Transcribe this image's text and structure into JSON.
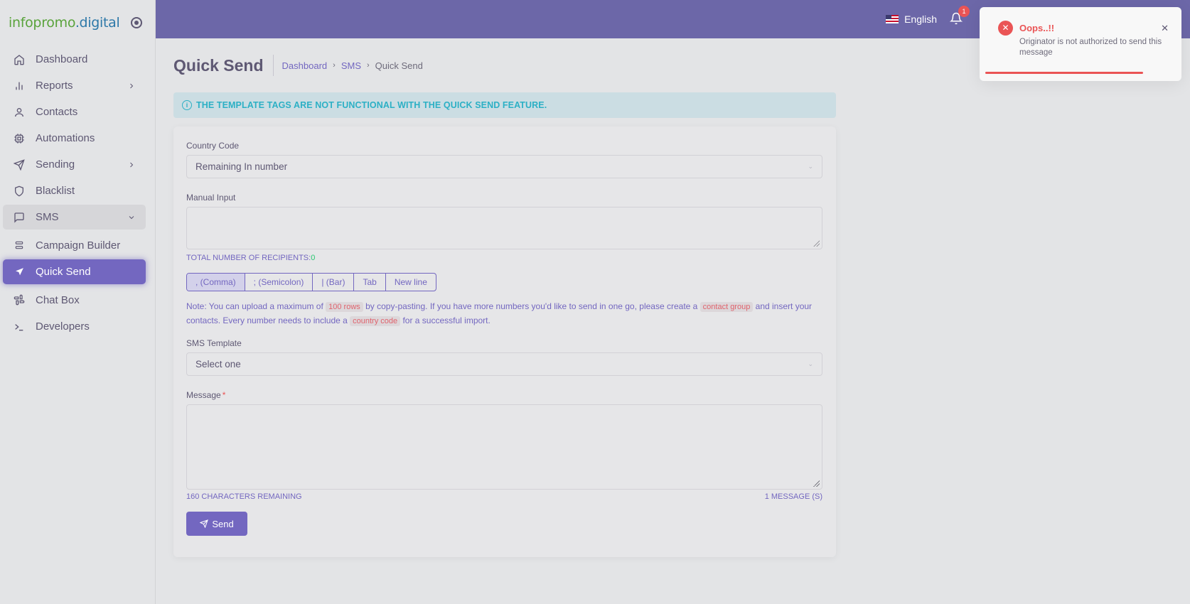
{
  "brand": {
    "part1": "infopromo",
    "part2": ".digital"
  },
  "sidebar": {
    "items": [
      {
        "label": "Dashboard"
      },
      {
        "label": "Reports"
      },
      {
        "label": "Contacts"
      },
      {
        "label": "Automations"
      },
      {
        "label": "Sending"
      },
      {
        "label": "Blacklist"
      },
      {
        "label": "SMS"
      },
      {
        "label": "Campaign Builder"
      },
      {
        "label": "Quick Send"
      },
      {
        "label": "Chat Box"
      },
      {
        "label": "Developers"
      }
    ]
  },
  "header": {
    "language": "English",
    "notifications_count": "1"
  },
  "page": {
    "title": "Quick Send",
    "breadcrumb": [
      "Dashboard",
      "SMS",
      "Quick Send"
    ]
  },
  "alert": {
    "text": "THE TEMPLATE TAGS ARE NOT FUNCTIONAL WITH THE QUICK SEND FEATURE."
  },
  "form": {
    "country_code_label": "Country Code",
    "country_code_value": "Remaining In number",
    "manual_input_label": "Manual Input",
    "recipients_label": "TOTAL NUMBER OF RECIPIENTS:",
    "recipients_count": "0",
    "delimiters": [
      ", (Comma)",
      "; (Semicolon)",
      "| (Bar)",
      "Tab",
      "New line"
    ],
    "note": {
      "p1": "Note: You can upload a maximum of ",
      "code1": "100 rows",
      "p2": " by copy-pasting. If you have more numbers you'd like to send in one go, please create a ",
      "code2": "contact group",
      "p3": " and insert your contacts. Every number needs to include a ",
      "code3": "country code",
      "p4": " for a successful import."
    },
    "template_label": "SMS Template",
    "template_value": "Select one",
    "message_label": "Message",
    "message_required": "*",
    "chars_remaining": "160 CHARACTERS REMAINING",
    "message_count": "1 MESSAGE (S)",
    "send_label": "Send"
  },
  "toast": {
    "title": "Oops..!!",
    "message": "Originator is not authorized to send this message"
  },
  "colors": {
    "primary": "#7367c0",
    "header": "#6c67a8",
    "danger": "#ea5455",
    "info": "#2cb0c5"
  }
}
